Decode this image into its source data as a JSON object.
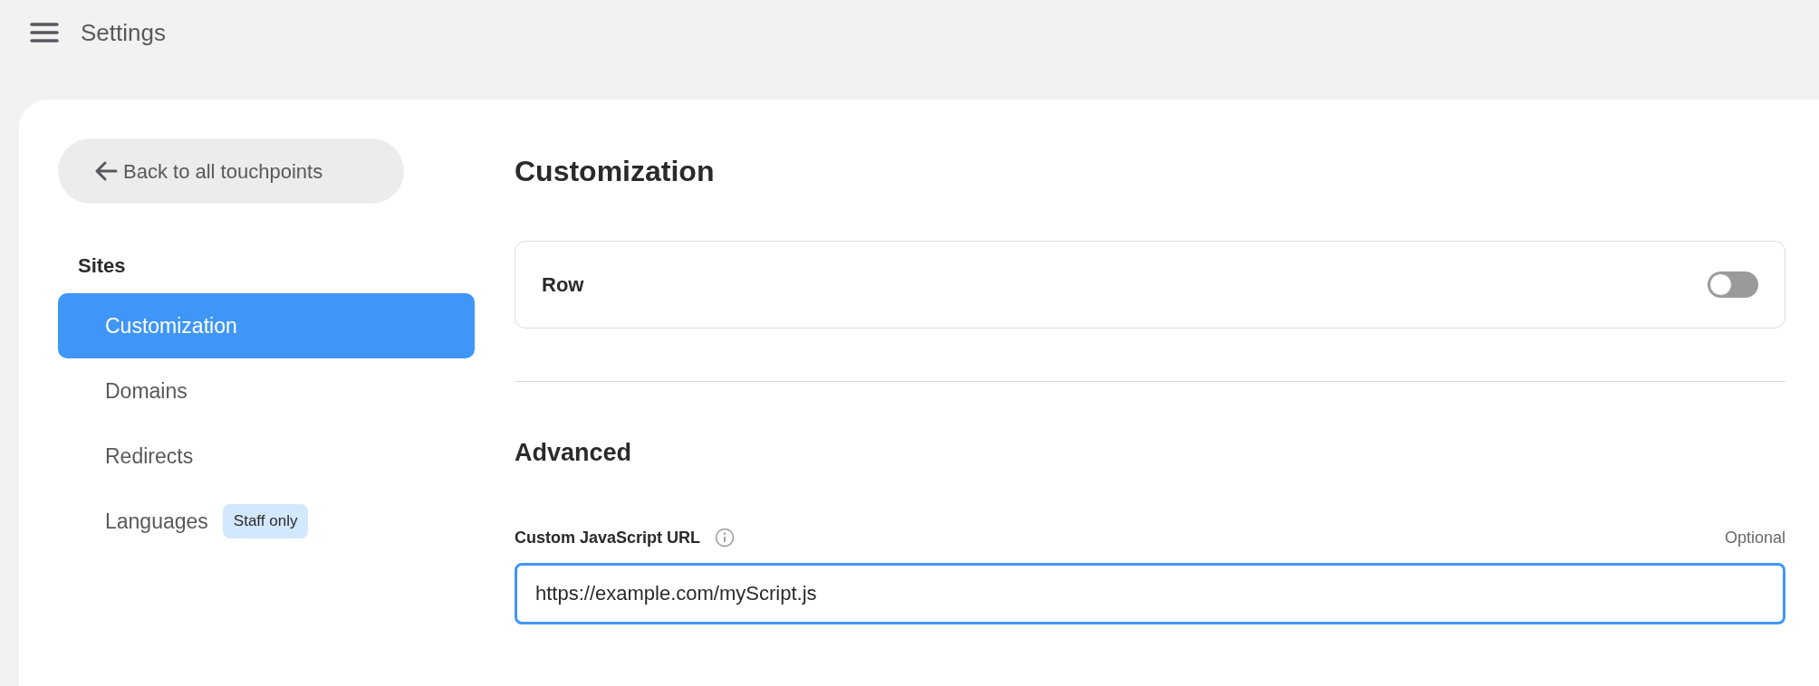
{
  "header": {
    "title": "Settings"
  },
  "sidebar": {
    "back_button": "Back to all touchpoints",
    "section": "Sites",
    "items": [
      {
        "label": "Customization",
        "selected": true
      },
      {
        "label": "Domains",
        "selected": false
      },
      {
        "label": "Redirects",
        "selected": false
      },
      {
        "label": "Languages",
        "selected": false,
        "badge": "Staff only"
      }
    ]
  },
  "content": {
    "title": "Customization",
    "toggle_row": {
      "label": "Row",
      "on": false
    },
    "advanced": {
      "title": "Advanced",
      "field": {
        "label": "Custom JavaScript URL",
        "hint": "Optional",
        "value": "https://example.com/myScript.js",
        "focused": true
      }
    }
  }
}
